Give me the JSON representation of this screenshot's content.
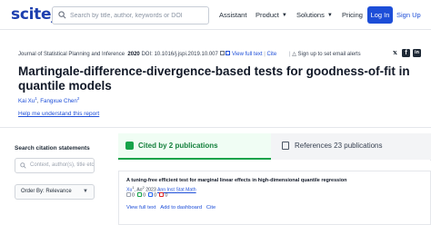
{
  "nav": {
    "logo": "scite_",
    "search_placeholder": "Search by title, author, keywords or DOI",
    "assistant": "Assistant",
    "product": "Product",
    "solutions": "Solutions",
    "pricing": "Pricing",
    "login": "Log In",
    "signup": "Sign Up"
  },
  "paper": {
    "journal": "Journal of Statistical Planning and Inference",
    "year": "2020",
    "doi": "DOI: 10.1016/j.jspi.2019.10.007",
    "view_full_text": "View full text",
    "cite": "Cite",
    "alerts": "Sign up to set email alerts",
    "title": "Martingale-difference-divergence-based tests for goodness-of-fit in quantile models",
    "author1": "Kai Xu",
    "author1_sup": "1",
    "author_sep": ",",
    "author2": "Fangxue Chen",
    "author2_sup": "2",
    "help_link": "Help me understand this report"
  },
  "sidebar": {
    "search_title": "Search citation statements",
    "search_placeholder": "Context, author(s), title etc",
    "order_by": "Order By: Relevance"
  },
  "tabs": {
    "cited_by": "Cited by 2 publications",
    "references": "References 23 publications"
  },
  "citing": {
    "title": "A tuning-free efficient test for marginal linear effects in high-dimensional quantile regression",
    "author": "Xu",
    "author_sup": "1",
    "coauthor": ", Ao",
    "coauthor_sup": "2",
    "year": "2023",
    "journal": "Ann Inst Stat Math",
    "counts": [
      "0",
      "0",
      "0",
      "0"
    ],
    "view_full_text": "View full text",
    "add_to_dashboard": "Add to dashboard",
    "cite": "Cite"
  },
  "colors": {
    "brand": "#1d4ed8",
    "supporting": "#16a34a",
    "title_text": "#111827"
  }
}
